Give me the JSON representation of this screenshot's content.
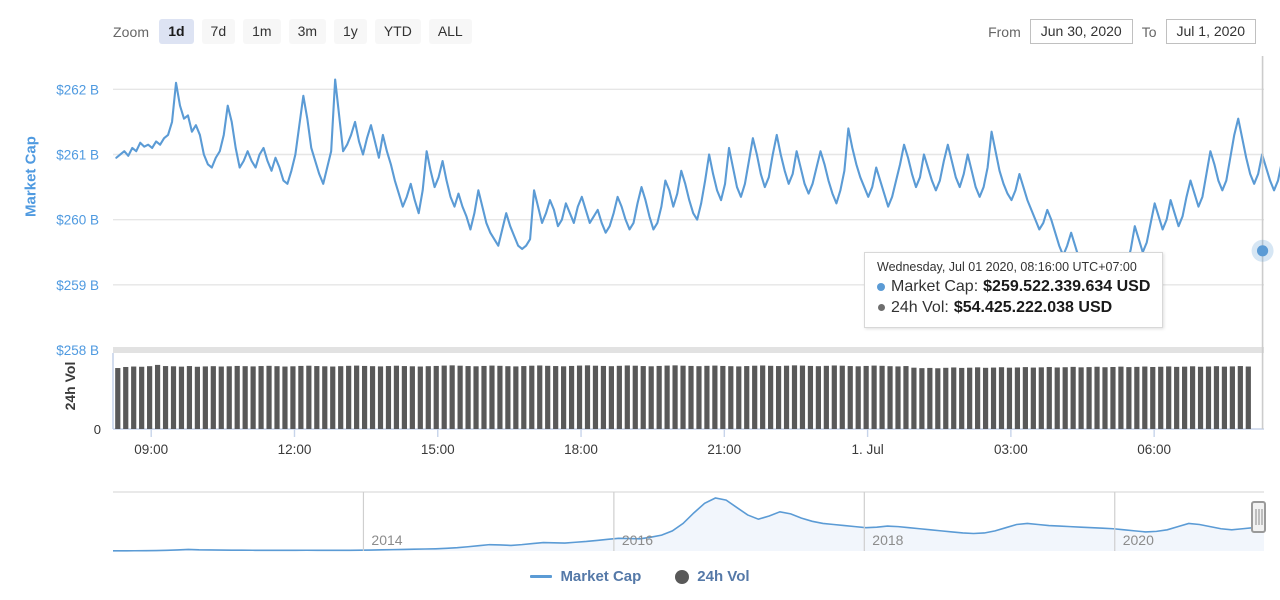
{
  "toolbar": {
    "zoom_label": "Zoom",
    "zoom_buttons": [
      {
        "label": "1d",
        "active": true
      },
      {
        "label": "7d",
        "active": false
      },
      {
        "label": "1m",
        "active": false
      },
      {
        "label": "3m",
        "active": false
      },
      {
        "label": "1y",
        "active": false
      },
      {
        "label": "YTD",
        "active": false
      },
      {
        "label": "ALL",
        "active": false
      }
    ],
    "from_label": "From",
    "from_value": "Jun 30, 2020",
    "to_label": "To",
    "to_value": "Jul 1, 2020"
  },
  "tooltip": {
    "date": "Wednesday, Jul 01 2020, 08:16:00 UTC+07:00",
    "rows": [
      {
        "name": "Market Cap:",
        "value": "$259.522.339.634 USD",
        "color": "#5b9bd5"
      },
      {
        "name": "24h Vol:",
        "value": "$54.425.222.038 USD",
        "color": "#6e6e6e"
      }
    ]
  },
  "legend": [
    {
      "label": "Market Cap",
      "marker": "line",
      "color": "#5b9bd5"
    },
    {
      "label": "24h Vol",
      "marker": "dot",
      "color": "#595959"
    }
  ],
  "colors": {
    "market_cap": "#5b9bd5",
    "volume": "#595959",
    "axis_label_blue": "#4f9ae0",
    "gridline": "#e6e6e6",
    "active_button_bg": "#dde3f3",
    "navigator_fill": "#f2f6fc",
    "crosshair": "#cccccc"
  },
  "chart_data": {
    "type": "line",
    "title": "",
    "xlabel": "",
    "ylabel": "Market Cap",
    "grid": true,
    "legend_position": "bottom",
    "axes": {
      "y_market_cap": {
        "label": "Market Cap",
        "ticks": [
          258,
          259,
          260,
          261,
          262
        ],
        "tick_labels": [
          "$258 B",
          "$259 B",
          "$260 B",
          "$261 B",
          "$262 B"
        ],
        "ylim": [
          258,
          262.45
        ],
        "unit": "USD billions"
      },
      "y_volume": {
        "label": "24h Vol",
        "ticks": [
          0
        ],
        "tick_labels": [
          "0"
        ],
        "ylim": [
          0,
          62
        ]
      },
      "x": {
        "tick_labels": [
          "09:00",
          "12:00",
          "15:00",
          "18:00",
          "21:00",
          "1. Jul",
          "03:00",
          "06:00"
        ],
        "tick_hours": [
          9,
          12,
          15,
          18,
          21,
          24,
          27,
          30
        ],
        "range_hours": [
          8.2,
          32.3
        ]
      }
    },
    "series": [
      {
        "name": "Market Cap",
        "unit": "USD billions",
        "color": "#5b9bd5",
        "type": "line",
        "x_start_hour": 8.27,
        "x_step_hour": 0.0833,
        "values": [
          260.95,
          261.0,
          261.05,
          260.98,
          261.1,
          261.05,
          261.18,
          261.12,
          261.15,
          261.1,
          261.2,
          261.15,
          261.25,
          261.3,
          261.5,
          262.1,
          261.75,
          261.55,
          261.6,
          261.35,
          261.45,
          261.3,
          261.0,
          260.85,
          260.8,
          260.95,
          261.05,
          261.3,
          261.75,
          261.5,
          261.1,
          260.8,
          260.9,
          261.05,
          260.9,
          260.8,
          261.0,
          261.1,
          260.9,
          260.75,
          260.95,
          260.8,
          260.6,
          260.55,
          260.75,
          261.0,
          261.45,
          261.9,
          261.55,
          261.1,
          260.9,
          260.7,
          260.55,
          260.8,
          261.05,
          262.15,
          261.6,
          261.05,
          261.15,
          261.3,
          261.5,
          261.2,
          261.0,
          261.25,
          261.45,
          261.2,
          260.95,
          261.3,
          261.05,
          260.85,
          260.6,
          260.4,
          260.2,
          260.35,
          260.55,
          260.3,
          260.1,
          260.45,
          261.05,
          260.75,
          260.5,
          260.65,
          260.9,
          260.6,
          260.35,
          260.2,
          260.4,
          260.2,
          260.05,
          259.85,
          260.1,
          260.45,
          260.2,
          259.95,
          259.8,
          259.7,
          259.6,
          259.85,
          260.1,
          259.9,
          259.75,
          259.6,
          259.55,
          259.6,
          259.7,
          260.45,
          260.2,
          259.95,
          260.1,
          260.3,
          260.15,
          259.9,
          260.0,
          260.25,
          260.1,
          259.95,
          260.2,
          260.35,
          260.15,
          259.95,
          260.05,
          260.15,
          259.95,
          259.8,
          259.9,
          260.1,
          260.35,
          260.2,
          260.0,
          259.85,
          259.95,
          260.25,
          260.5,
          260.3,
          260.05,
          259.85,
          259.95,
          260.2,
          260.6,
          260.45,
          260.2,
          260.4,
          260.75,
          260.55,
          260.3,
          260.1,
          260.0,
          260.25,
          260.6,
          261.0,
          260.7,
          260.45,
          260.3,
          260.55,
          261.1,
          260.8,
          260.5,
          260.35,
          260.55,
          260.9,
          261.25,
          261.0,
          260.7,
          260.5,
          260.65,
          261.0,
          261.3,
          261.0,
          260.75,
          260.55,
          260.7,
          261.05,
          260.8,
          260.55,
          260.4,
          260.55,
          260.8,
          261.05,
          260.85,
          260.6,
          260.4,
          260.25,
          260.45,
          260.75,
          261.4,
          261.1,
          260.85,
          260.65,
          260.5,
          260.35,
          260.5,
          260.8,
          260.6,
          260.4,
          260.2,
          260.35,
          260.6,
          260.85,
          261.15,
          260.95,
          260.7,
          260.5,
          260.65,
          261.0,
          260.8,
          260.6,
          260.45,
          260.6,
          260.9,
          261.15,
          260.9,
          260.65,
          260.5,
          260.7,
          261.0,
          260.75,
          260.5,
          260.35,
          260.5,
          260.8,
          261.35,
          261.05,
          260.75,
          260.55,
          260.4,
          260.3,
          260.45,
          260.7,
          260.5,
          260.3,
          260.15,
          260.0,
          259.85,
          259.95,
          260.15,
          260.0,
          259.8,
          259.6,
          259.45,
          259.6,
          259.8,
          259.6,
          259.4,
          259.25,
          259.1,
          258.95,
          258.8,
          258.68,
          258.9,
          259.2,
          259.1,
          258.95,
          259.15,
          259.45,
          259.3,
          259.55,
          259.9,
          259.7,
          259.5,
          259.65,
          259.95,
          260.25,
          260.05,
          259.85,
          260.0,
          260.3,
          260.1,
          259.9,
          260.05,
          260.35,
          260.6,
          260.4,
          260.2,
          260.35,
          260.7,
          261.05,
          260.85,
          260.6,
          260.45,
          260.6,
          260.95,
          261.3,
          261.55,
          261.25,
          260.95,
          260.7,
          260.55,
          260.7,
          261.0,
          260.8,
          260.6,
          260.45,
          260.6,
          260.9,
          260.7,
          260.5,
          260.35,
          260.5,
          260.8,
          261.1,
          260.85,
          260.6,
          260.45,
          260.6,
          260.9,
          261.2,
          260.95,
          260.7,
          260.5,
          260.65,
          261.0,
          261.35,
          261.6,
          261.3,
          261.0,
          260.75,
          260.55,
          260.4,
          260.55,
          260.85,
          261.15,
          260.9,
          260.65,
          260.5,
          260.35,
          260.5,
          260.75,
          261.0,
          260.8,
          260.6,
          260.45,
          260.3,
          260.45,
          260.7,
          260.95,
          260.75,
          260.55,
          260.4,
          260.55,
          260.8,
          261.1,
          261.4,
          261.7,
          261.4,
          261.1,
          260.85,
          260.65,
          260.5,
          260.35,
          260.5,
          260.75,
          260.55,
          260.35,
          260.5,
          260.8,
          260.6,
          260.4,
          260.55,
          260.85,
          260.65,
          260.45,
          260.3,
          260.15,
          260.3,
          260.55,
          260.35,
          260.2,
          260.35,
          260.6,
          260.4,
          260.25,
          260.1,
          260.25,
          260.5,
          260.3,
          260.15,
          260.3,
          260.55,
          260.35,
          260.2,
          260.35,
          260.65,
          261.25,
          260.95,
          260.7,
          260.5,
          260.35,
          260.2,
          260.35,
          260.6,
          260.4,
          260.2,
          260.05,
          260.2,
          260.45,
          260.25,
          260.1,
          259.95,
          260.1,
          260.35,
          260.15,
          260.0,
          260.15,
          260.4,
          261.0,
          260.75,
          260.5,
          260.3,
          260.15,
          260.3,
          260.55,
          260.35,
          260.2,
          260.35,
          260.6,
          260.9,
          261.25,
          260.95,
          260.7,
          260.5,
          260.35,
          260.5,
          260.75,
          261.05,
          261.45,
          261.15,
          260.9,
          260.7,
          260.55,
          260.7,
          261.0,
          260.8,
          260.6,
          260.45,
          260.6,
          260.85,
          261.15,
          260.9,
          260.7,
          260.5,
          260.35,
          260.5,
          260.75,
          261.55,
          261.2,
          260.95,
          260.75,
          260.55,
          260.4,
          260.55,
          260.8,
          261.1,
          260.85,
          260.65,
          260.5,
          260.35,
          260.5,
          260.7,
          260.95,
          261.25,
          261.0,
          260.8,
          260.6,
          260.45,
          260.6,
          260.85,
          261.05,
          260.85,
          260.65,
          260.5,
          260.35,
          260.5,
          260.7,
          260.9,
          260.7,
          260.5,
          260.35,
          260.2,
          260.35,
          260.55,
          260.8,
          260.6,
          260.4,
          260.25,
          260.1,
          260.25,
          260.45,
          260.7,
          260.5,
          260.3,
          260.15,
          260.0,
          260.15,
          260.35,
          260.55,
          260.35,
          260.2,
          260.05,
          259.9,
          260.0,
          260.2,
          260.4,
          260.2,
          260.05,
          259.9,
          259.75,
          259.85,
          260.05,
          260.25,
          260.1,
          259.95,
          259.8,
          259.65,
          259.75,
          259.9,
          259.8,
          259.65,
          259.55,
          259.45,
          259.55,
          259.52,
          259.58,
          259.62,
          259.75,
          260.15,
          260.05,
          259.95
        ],
        "highlight_point": {
          "hour": 32.27,
          "value": 259.522339634,
          "label": "$259.522.339.634 USD"
        }
      },
      {
        "name": "24h Vol",
        "unit": "USD billions",
        "color": "#595959",
        "type": "column",
        "x_start_hour": 8.3,
        "x_step_hour": 0.1667,
        "values": [
          52.5,
          53.4,
          53.8,
          53.6,
          54.1,
          55.2,
          54.2,
          54.0,
          53.7,
          54.2,
          53.6,
          53.9,
          54.1,
          53.8,
          54.0,
          54.3,
          54.1,
          53.9,
          54.2,
          54.4,
          54.1,
          53.8,
          54.0,
          54.3,
          54.5,
          54.2,
          54.0,
          53.8,
          54.1,
          54.4,
          54.6,
          54.3,
          54.1,
          53.9,
          54.2,
          54.5,
          54.2,
          54.0,
          53.8,
          54.1,
          54.3,
          54.6,
          54.8,
          54.5,
          54.2,
          54.0,
          54.3,
          54.6,
          54.4,
          54.1,
          53.9,
          54.2,
          54.5,
          54.7,
          54.4,
          54.2,
          54.0,
          54.3,
          54.6,
          54.8,
          54.5,
          54.3,
          54.1,
          54.4,
          54.7,
          54.5,
          54.2,
          54.0,
          54.3,
          54.6,
          54.8,
          54.5,
          54.3,
          54.1,
          54.4,
          54.6,
          54.3,
          54.1,
          53.9,
          54.2,
          54.5,
          54.7,
          54.4,
          54.2,
          54.5,
          54.8,
          54.6,
          54.3,
          54.1,
          54.4,
          54.7,
          54.5,
          54.2,
          54.0,
          54.3,
          54.6,
          54.4,
          54.1,
          53.9,
          54.2,
          52.8,
          52.4,
          52.6,
          52.3,
          52.7,
          53.0,
          52.6,
          52.8,
          53.1,
          52.7,
          52.9,
          53.2,
          52.8,
          53.0,
          53.3,
          52.9,
          53.1,
          53.4,
          53.0,
          53.2,
          53.5,
          53.1,
          53.3,
          53.6,
          53.2,
          53.4,
          53.7,
          53.3,
          53.5,
          53.8,
          53.4,
          53.6,
          53.9,
          53.5,
          53.7,
          54.0,
          53.6,
          53.8,
          54.1,
          53.7,
          53.9,
          54.2,
          53.8,
          54.0,
          54.3,
          53.9,
          54.1,
          54.4,
          54.0,
          54.2,
          54.4,
          54.1,
          54.3,
          54.0,
          54.2,
          54.4
        ]
      }
    ],
    "navigator": {
      "tick_labels": [
        "2014",
        "2016",
        "2018",
        "2020"
      ],
      "series_name": "Market Cap",
      "points": [
        0.004,
        0.004,
        0.005,
        0.006,
        0.008,
        0.012,
        0.02,
        0.03,
        0.022,
        0.02,
        0.018,
        0.016,
        0.015,
        0.014,
        0.013,
        0.012,
        0.012,
        0.013,
        0.014,
        0.013,
        0.012,
        0.012,
        0.013,
        0.015,
        0.018,
        0.022,
        0.026,
        0.03,
        0.034,
        0.038,
        0.042,
        0.05,
        0.062,
        0.08,
        0.1,
        0.12,
        0.115,
        0.105,
        0.12,
        0.14,
        0.16,
        0.155,
        0.15,
        0.165,
        0.18,
        0.2,
        0.22,
        0.24,
        0.235,
        0.23,
        0.26,
        0.3,
        0.38,
        0.52,
        0.72,
        0.9,
        1.0,
        0.96,
        0.82,
        0.68,
        0.6,
        0.66,
        0.74,
        0.7,
        0.62,
        0.56,
        0.52,
        0.5,
        0.48,
        0.46,
        0.44,
        0.45,
        0.47,
        0.46,
        0.44,
        0.42,
        0.4,
        0.38,
        0.36,
        0.34,
        0.33,
        0.34,
        0.38,
        0.44,
        0.5,
        0.52,
        0.5,
        0.48,
        0.47,
        0.46,
        0.45,
        0.44,
        0.43,
        0.42,
        0.4,
        0.38,
        0.36,
        0.37,
        0.4,
        0.46,
        0.52,
        0.5,
        0.46,
        0.42,
        0.4,
        0.42,
        0.44,
        0.46
      ],
      "handle_position": "right"
    }
  }
}
